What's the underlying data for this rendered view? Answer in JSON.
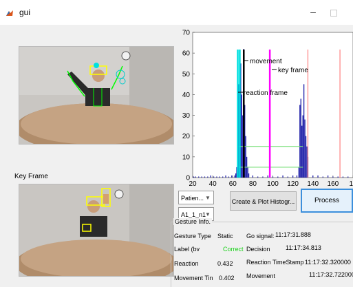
{
  "window": {
    "title": "gui",
    "minimize": "–"
  },
  "key_frame_label": "Key Frame",
  "dropdowns": [
    {
      "value": "Patien..."
    },
    {
      "value": "A1_1_n1"
    }
  ],
  "buttons": {
    "create_plot": "Create & Plot Histogr...",
    "process": "Process"
  },
  "gesture_info": {
    "title": "Gesture Info.",
    "gesture_type_label": "Gesture Type",
    "gesture_type_value": "Static",
    "label_label": "Label (bv",
    "label_value": "Correct",
    "reaction_label": "Reaction",
    "reaction_value": "0.432",
    "movement_time_label": "Movement Tin",
    "movement_time_value": "0.402",
    "go_signal_label": "Go signal:",
    "go_signal_value": "11:17:31.888",
    "decision_label": "Decision",
    "decision_value": "11:17:34.813",
    "reaction_timestamp_label": "Reaction TimeStamp",
    "reaction_timestamp_value": "11:17:32.320000",
    "movement_label": "Movement",
    "movement_value": "11:17:32.722000"
  },
  "chart_data": {
    "type": "bar",
    "xlim": [
      20,
      180
    ],
    "ylim": [
      0,
      70
    ],
    "xticks": [
      "20",
      "40",
      "60",
      "80",
      "100",
      "120",
      "140",
      "160",
      "18"
    ],
    "yticks": [
      "0",
      "10",
      "20",
      "30",
      "40",
      "50",
      "60",
      "70"
    ],
    "annotations": [
      "movement",
      "key frame",
      "reaction frame"
    ],
    "vertical_lines": [
      {
        "x": 65,
        "color": "#00e0e0"
      },
      {
        "x": 67,
        "color": "#00e0e0"
      },
      {
        "x": 71,
        "color": "#000000"
      },
      {
        "x": 97,
        "color": "#ff00ff"
      },
      {
        "x": 135,
        "color": "#ff7f7f"
      },
      {
        "x": 167,
        "color": "#ff7f7f"
      }
    ],
    "horizontal_lines": [
      {
        "y": 15,
        "x_from": 66,
        "x_to": 130,
        "color": "#7ee07e"
      },
      {
        "y": 5,
        "x_from": 66,
        "x_to": 130,
        "color": "#7ee07e"
      }
    ],
    "bars": [
      [
        21,
        0.5
      ],
      [
        23,
        0.5
      ],
      [
        26,
        0.5
      ],
      [
        29,
        0.5
      ],
      [
        32,
        0.5
      ],
      [
        35,
        0.5
      ],
      [
        38,
        1
      ],
      [
        41,
        0.5
      ],
      [
        44,
        0.5
      ],
      [
        47,
        0.5
      ],
      [
        50,
        0.5
      ],
      [
        53,
        1
      ],
      [
        56,
        0.5
      ],
      [
        59,
        1
      ],
      [
        62,
        1
      ],
      [
        63,
        2
      ],
      [
        64,
        5
      ],
      [
        65,
        20
      ],
      [
        66,
        45
      ],
      [
        67,
        60
      ],
      [
        68,
        55
      ],
      [
        69,
        40
      ],
      [
        70,
        30
      ],
      [
        71,
        62
      ],
      [
        72,
        35
      ],
      [
        73,
        20
      ],
      [
        74,
        10
      ],
      [
        75,
        5
      ],
      [
        76,
        2
      ],
      [
        80,
        1
      ],
      [
        85,
        0.5
      ],
      [
        90,
        0.5
      ],
      [
        95,
        1
      ],
      [
        100,
        0.5
      ],
      [
        105,
        0.5
      ],
      [
        110,
        1
      ],
      [
        115,
        0.5
      ],
      [
        120,
        1
      ],
      [
        124,
        1
      ],
      [
        126,
        5
      ],
      [
        127,
        35
      ],
      [
        128,
        38
      ],
      [
        129,
        25
      ],
      [
        130,
        30
      ],
      [
        131,
        45
      ],
      [
        132,
        28
      ],
      [
        133,
        20
      ],
      [
        134,
        15
      ],
      [
        135,
        10
      ],
      [
        140,
        1
      ],
      [
        145,
        1
      ],
      [
        150,
        0.5
      ],
      [
        155,
        1
      ],
      [
        160,
        0.5
      ],
      [
        165,
        0.5
      ],
      [
        170,
        0.5
      ],
      [
        175,
        0.5
      ]
    ]
  }
}
